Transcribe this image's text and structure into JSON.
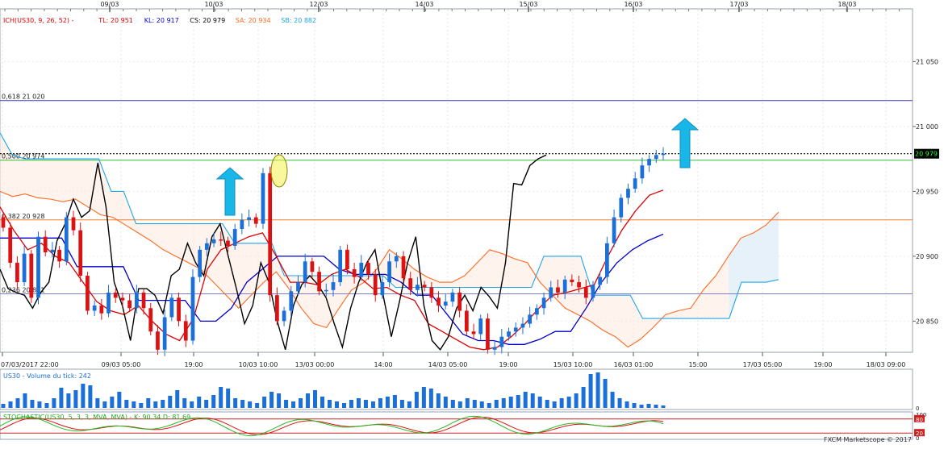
{
  "chart_data": [
    {
      "type": "candlestick",
      "ichimoku_legend": [
        {
          "text": "ICH(US30, 9, 26, 52) -",
          "color": "#dd0000"
        },
        {
          "text": "TL: 20 951",
          "color": "#dd0000"
        },
        {
          "text": "KL: 20 917",
          "color": "#0000cc"
        },
        {
          "text": "CS: 20 979",
          "color": "#000000"
        },
        {
          "text": "SA: 20 934",
          "color": "#ff6a20"
        },
        {
          "text": "SB: 20 882",
          "color": "#1ea6e8"
        }
      ],
      "top_dates": [
        "09/03",
        "10/03",
        "12/03",
        "14/03",
        "15/03",
        "16/03",
        "17/03",
        "18/03"
      ],
      "bottom_time_labels": [
        "07/03/2017 22:00",
        "09/03 05:00",
        "19:00",
        "10/03 10:00",
        "13/03 00:00",
        "14:00",
        "14/03 05:00",
        "19:00",
        "15/03 10:00",
        "16/03 01:00",
        "15:00",
        "17/03 05:00",
        "19:00",
        "18/03 09:00"
      ],
      "y_ticks": [
        20850,
        20900,
        20950,
        21000,
        21050
      ],
      "y_tick_labels": [
        "20 850",
        "20 900",
        "20 950",
        "21 000",
        "21 050"
      ],
      "ylim": [
        20826,
        21090
      ],
      "fib_levels": [
        {
          "label": "0,618 21 020",
          "value": 21020,
          "color": "#3c3ca0"
        },
        {
          "label": "0,500 20 974",
          "value": 20974,
          "color": "#33bb33"
        },
        {
          "label": "0,382 20 928",
          "value": 20928,
          "color": "#f08030"
        },
        {
          "label": "0,236 20 871",
          "value": 20871,
          "color": "#8080c0"
        }
      ],
      "current_price": {
        "label": "20 979",
        "value": 20979
      },
      "price_path": [
        20922,
        20895,
        20880,
        20902,
        20868,
        20915,
        20903,
        20905,
        20896,
        20930,
        20920,
        20885,
        20858,
        20862,
        20856,
        20872,
        20868,
        20866,
        20860,
        20872,
        20860,
        20842,
        20828,
        20853,
        20868,
        20850,
        20835,
        20884,
        20905,
        20910,
        20913,
        20912,
        20908,
        20921,
        20928,
        20930,
        20925,
        20964,
        20870,
        20850,
        20858,
        20873,
        20880,
        20896,
        20888,
        20873,
        20874,
        20880,
        20905,
        20890,
        20884,
        20895,
        20886,
        20870,
        20880,
        20896,
        20900,
        20883,
        20874,
        20878,
        20876,
        20868,
        20862,
        20865,
        20872,
        20858,
        20842,
        20840,
        20852,
        20828,
        20830,
        20838,
        20842,
        20845,
        20848,
        20855,
        20860,
        20868,
        20876,
        20872,
        20882,
        20880,
        20876,
        20868,
        20878,
        20884,
        20910,
        20930,
        20945,
        20952,
        20960,
        20970,
        20975,
        20978,
        20979
      ],
      "tenkan_path": [
        20938,
        20920,
        20905,
        20910,
        20900,
        20895,
        20880,
        20865,
        20858,
        20855,
        20862,
        20850,
        20840,
        20835,
        20852,
        20890,
        20905,
        20910,
        20915,
        20918,
        20900,
        20880,
        20880,
        20878,
        20886,
        20890,
        20884,
        20875,
        20876,
        20870,
        20866,
        20848,
        20842,
        20836,
        20830,
        20828,
        20830,
        20838,
        20848,
        20860,
        20870,
        20872,
        20875,
        20878,
        20900,
        20920,
        20935,
        20947,
        20951
      ],
      "kijun_path": [
        20914,
        20914,
        20914,
        20914,
        20914,
        20892,
        20892,
        20892,
        20892,
        20866,
        20866,
        20866,
        20866,
        20850,
        20850,
        20860,
        20880,
        20890,
        20900,
        20900,
        20900,
        20900,
        20890,
        20886,
        20886,
        20886,
        20880,
        20870,
        20870,
        20855,
        20840,
        20835,
        20835,
        20832,
        20832,
        20836,
        20842,
        20842,
        20860,
        20880,
        20895,
        20905,
        20912,
        20917
      ],
      "senkou_a_path": [
        20950,
        20946,
        20948,
        20945,
        20944,
        20942,
        20944,
        20938,
        20932,
        20930,
        20924,
        20918,
        20912,
        20905,
        20900,
        20895,
        20890,
        20880,
        20870,
        20860,
        20870,
        20880,
        20888,
        20875,
        20860,
        20848,
        20845,
        20860,
        20874,
        20880,
        20890,
        20905,
        20898,
        20890,
        20884,
        20880,
        20880,
        20885,
        20895,
        20905,
        20902,
        20898,
        20895,
        20880,
        20870,
        20860,
        20855,
        20850,
        20843,
        20838,
        20830,
        20836,
        20845,
        20855,
        20858,
        20860,
        20874,
        20885,
        20900,
        20914,
        20918,
        20924,
        20934
      ],
      "senkou_b_path": [
        20995,
        20978,
        20975,
        20975,
        20975,
        20975,
        20975,
        20975,
        20975,
        20950,
        20950,
        20925,
        20925,
        20925,
        20925,
        20925,
        20925,
        20925,
        20925,
        20910,
        20910,
        20910,
        20910,
        20885,
        20885,
        20885,
        20885,
        20885,
        20885,
        20885,
        20885,
        20885,
        20876,
        20876,
        20876,
        20876,
        20876,
        20876,
        20876,
        20876,
        20876,
        20876,
        20876,
        20876,
        20900,
        20900,
        20900,
        20900,
        20870,
        20870,
        20870,
        20870,
        20852,
        20852,
        20852,
        20852,
        20852,
        20852,
        20852,
        20852,
        20880,
        20880,
        20880,
        20882
      ],
      "chikou_path": [
        20890,
        20875,
        20872,
        20870,
        20860,
        20872,
        20880,
        20912,
        20925,
        20944,
        20930,
        20935,
        20972,
        20938,
        20880,
        20862,
        20835,
        20875,
        20875,
        20870,
        20856,
        20885,
        20890,
        20910,
        20895,
        20885,
        20915,
        20925,
        20900,
        20875,
        20848,
        20862,
        20895,
        20880,
        20850,
        20828,
        20862,
        20878,
        20885,
        20878,
        20868,
        20848,
        20830,
        20860,
        20880,
        20895,
        20905,
        20870,
        20838,
        20865,
        20895,
        20915,
        20862,
        20835,
        20828,
        20838,
        20860,
        20870,
        20858,
        20876,
        20869,
        20860,
        20895,
        20956,
        20955,
        20970,
        20975,
        20978
      ]
    },
    {
      "type": "bar",
      "title": "US30 - Volume du tick: 242",
      "y_tick_labels": [
        "0"
      ],
      "values": [
        5,
        8,
        12,
        18,
        10,
        8,
        6,
        12,
        25,
        18,
        22,
        30,
        28,
        12,
        8,
        14,
        20,
        10,
        8,
        6,
        12,
        8,
        10,
        15,
        22,
        12,
        8,
        14,
        10,
        16,
        26,
        24,
        12,
        10,
        8,
        6,
        14,
        20,
        18,
        10,
        8,
        12,
        18,
        22,
        14,
        10,
        8,
        6,
        10,
        12,
        10,
        8,
        12,
        14,
        16,
        10,
        8,
        20,
        26,
        24,
        18,
        14,
        10,
        8,
        12,
        10,
        8,
        6,
        10,
        12,
        14,
        16,
        20,
        18,
        14,
        10,
        8,
        12,
        14,
        18,
        26,
        42,
        44,
        36,
        20,
        12,
        8,
        6,
        4,
        5,
        4,
        3
      ]
    },
    {
      "type": "line",
      "title": "STOCHASTIC(US30, 5, 3, 3, MVA, MVA) - K: 90.34 D: 81.69",
      "y_tick_labels": [
        "100",
        "80",
        "20",
        "0"
      ]
    }
  ],
  "footer": {
    "credit": "FXCM Marketscope © 2017"
  }
}
